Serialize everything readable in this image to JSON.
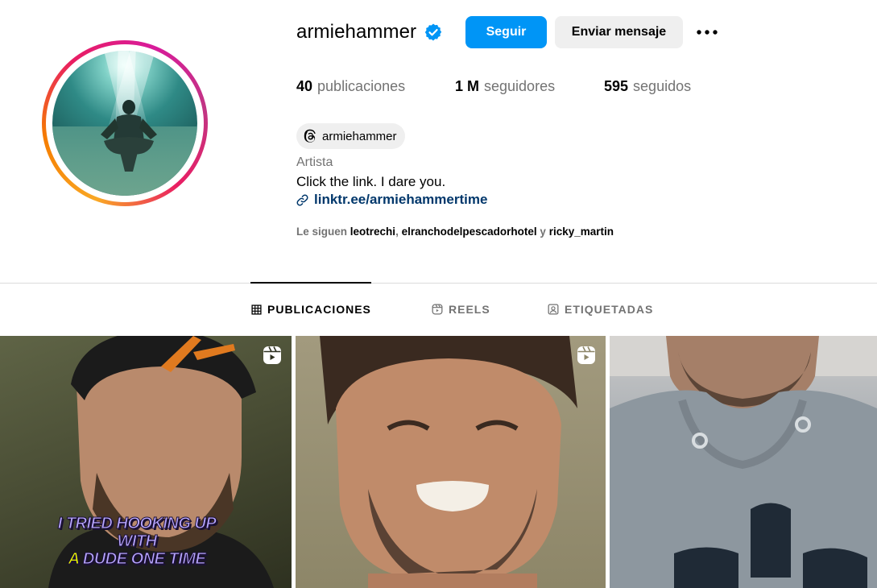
{
  "profile": {
    "username": "armiehammer",
    "verified": true,
    "buttons": {
      "follow": "Seguir",
      "message": "Enviar mensaje"
    },
    "stats": [
      {
        "count": "40",
        "label": "publicaciones"
      },
      {
        "count": "1 M",
        "label": "seguidores"
      },
      {
        "count": "595",
        "label": "seguidos"
      }
    ],
    "threads_handle": "armiehammer",
    "category": "Artista",
    "bio": "Click the link. I dare you.",
    "link": "linktr.ee/armiehammertime",
    "followed_by": {
      "prefix": "Le siguen",
      "accounts": [
        "leotrechi",
        "elranchodelpescadorhotel",
        "ricky_martin"
      ],
      "separator": ",",
      "conjunction": "y"
    }
  },
  "tabs": [
    {
      "label": "PUBLICACIONES",
      "icon": "grid-icon",
      "active": true
    },
    {
      "label": "REELS",
      "icon": "reels-icon",
      "active": false
    },
    {
      "label": "ETIQUETADAS",
      "icon": "tagged-icon",
      "active": false
    }
  ],
  "posts": [
    {
      "type": "reel",
      "caption": [
        "I TRIED HOOKING UP",
        "WITH",
        "A",
        "DUDE ONE TIME"
      ]
    },
    {
      "type": "reel"
    },
    {
      "type": "image"
    }
  ],
  "colors": {
    "accent": "#0095f6",
    "link": "#00376b",
    "muted": "#737373",
    "chip_bg": "#efefef"
  }
}
